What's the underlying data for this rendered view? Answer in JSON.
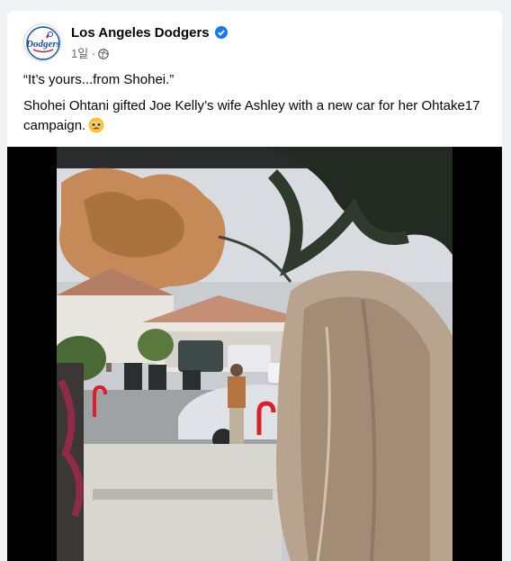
{
  "post": {
    "page_name": "Los Angeles Dodgers",
    "timestamp": "1일",
    "privacy_icon": "globe-icon",
    "verified_icon": "verified-badge-icon",
    "quote": "“It’s yours...from Shohei.”",
    "description": "Shohei Ohtani gifted Joe Kelly’s wife Ashley with a new car for her Ohtake17 campaign.",
    "emoji_icon": "pleading-face-emoji",
    "avatar_logo_text": "Dodgers"
  },
  "colors": {
    "verified_blue": "#1877f2",
    "dodger_blue": "#1a4b9c",
    "background": "#f0f2f5",
    "car_white": "#dfe3e8"
  }
}
